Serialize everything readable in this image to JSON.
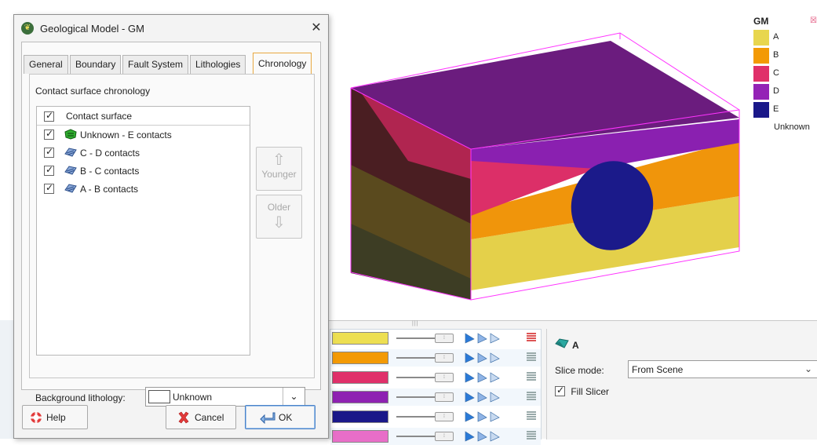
{
  "dialog": {
    "title": "Geological Model - GM",
    "close_glyph": "✕",
    "tabs": [
      "General",
      "Boundary",
      "Fault System",
      "Lithologies",
      "Chronology"
    ],
    "active_tab": "Chronology",
    "section_label": "Contact surface chronology",
    "list_header": "Contact surface",
    "contact_surfaces": [
      {
        "label": "Unknown - E contacts",
        "checked": true,
        "icon": "green-contact-icon"
      },
      {
        "label": "C - D contacts",
        "checked": true,
        "icon": "blue-contact-icon"
      },
      {
        "label": "B - C contacts",
        "checked": true,
        "icon": "blue-contact-icon"
      },
      {
        "label": "A - B contacts",
        "checked": true,
        "icon": "blue-contact-icon"
      }
    ],
    "younger_label": "Younger",
    "older_label": "Older",
    "background_label": "Background lithology:",
    "background_value": "Unknown",
    "help_label": "Help",
    "cancel_label": "Cancel",
    "ok_label": "OK"
  },
  "legend": {
    "title": "GM",
    "items": [
      {
        "label": "A",
        "color": "#e8d64e"
      },
      {
        "label": "B",
        "color": "#f39a05"
      },
      {
        "label": "C",
        "color": "#e0306a"
      },
      {
        "label": "D",
        "color": "#9423b6"
      },
      {
        "label": "E",
        "color": "#1a1889"
      },
      {
        "label": "Unknown",
        "color": "none"
      }
    ]
  },
  "lithology_rows": [
    {
      "color": "#eddf52",
      "active": true
    },
    {
      "color": "#f39a05",
      "active": false
    },
    {
      "color": "#e0306a",
      "active": false
    },
    {
      "color": "#8e22b2",
      "active": false
    },
    {
      "color": "#1a1889",
      "active": false
    },
    {
      "color": "#e86ec8",
      "active": false
    }
  ],
  "properties": {
    "title": "A",
    "slice_mode_label": "Slice mode:",
    "slice_mode_value": "From Scene",
    "fill_slicer_label": "Fill Slicer",
    "fill_slicer_checked": true
  }
}
